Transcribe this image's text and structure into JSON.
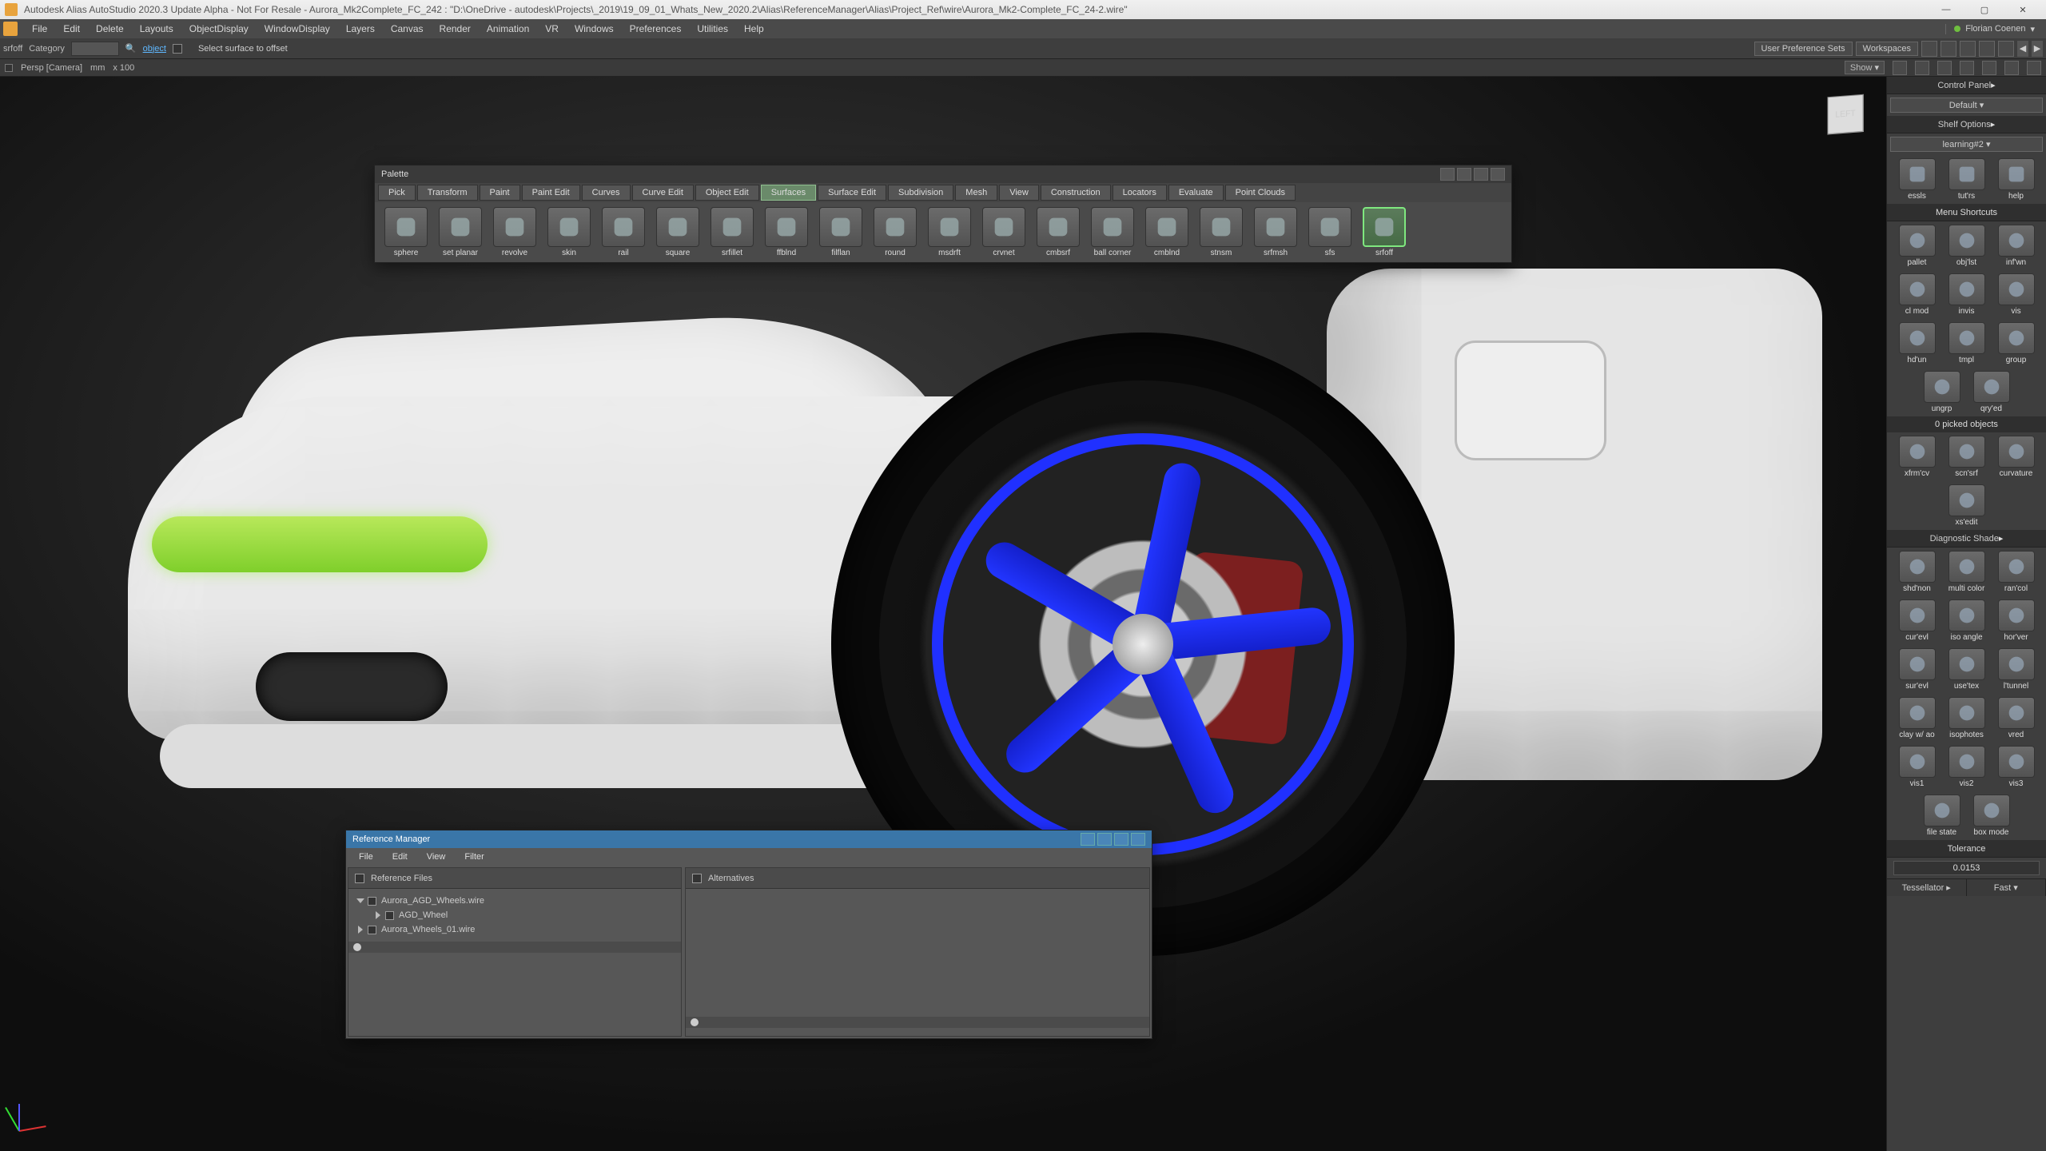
{
  "window": {
    "title": "Autodesk Alias AutoStudio 2020.3 Update Alpha - Not For Resale  -  Aurora_Mk2Complete_FC_242 : \"D:\\OneDrive - autodesk\\Projects\\_2019\\19_09_01_Whats_New_2020.2\\Alias\\ReferenceManager\\Alias\\Project_Ref\\wire\\Aurora_Mk2-Complete_FC_24-2.wire\"",
    "user": "Florian Coenen"
  },
  "menubar": [
    "File",
    "Edit",
    "Delete",
    "Layouts",
    "ObjectDisplay",
    "WindowDisplay",
    "Layers",
    "Canvas",
    "Render",
    "Animation",
    "VR",
    "Windows",
    "Preferences",
    "Utilities",
    "Help"
  ],
  "toolrow": {
    "active_tool": "srfoff",
    "category_label": "Category",
    "object_link": "object",
    "command_hint": "Select surface to offset",
    "user_pref": "User Preference Sets",
    "workspaces": "Workspaces"
  },
  "statusrow": {
    "camera": "Persp [Camera]",
    "units": "mm",
    "zoom": "x 100",
    "show": "Show"
  },
  "palette": {
    "title": "Palette",
    "tabs": [
      "Pick",
      "Transform",
      "Paint",
      "Paint Edit",
      "Curves",
      "Curve Edit",
      "Object Edit",
      "Surfaces",
      "Surface Edit",
      "Subdivision",
      "Mesh",
      "View",
      "Construction",
      "Locators",
      "Evaluate",
      "Point Clouds"
    ],
    "active_tab": "Surfaces",
    "tools": [
      "sphere",
      "set planar",
      "revolve",
      "skin",
      "rail",
      "square",
      "srfillet",
      "ffblnd",
      "filflan",
      "round",
      "msdrft",
      "crvnet",
      "cmbsrf",
      "ball corner",
      "cmblnd",
      "stnsm",
      "srfmsh",
      "sfs",
      "srfoff"
    ],
    "selected_tool": "srfoff"
  },
  "refmgr": {
    "title": "Reference Manager",
    "menus": [
      "File",
      "Edit",
      "View",
      "Filter"
    ],
    "left_header": "Reference Files",
    "right_header": "Alternatives",
    "tree": [
      {
        "label": "Aurora_AGD_Wheels.wire",
        "depth": 0,
        "expanded": true,
        "dim": false
      },
      {
        "label": "AGD_Wheel",
        "depth": 1,
        "expanded": false,
        "dim": false
      },
      {
        "label": "Aurora_Wheels_01.wire",
        "depth": 0,
        "expanded": false,
        "dim": true
      }
    ]
  },
  "sidepanel": {
    "control_panel": "Control Panel",
    "default": "Default",
    "shelf_options": "Shelf Options",
    "shelf_preset": "learning#2",
    "row1": [
      {
        "name": "essls",
        "label": "essls"
      },
      {
        "name": "tutrs",
        "label": "tut'rs"
      },
      {
        "name": "help",
        "label": "help"
      }
    ],
    "menu_shortcuts": "Menu Shortcuts",
    "shortcut_rows": [
      [
        {
          "n": "pallet",
          "l": "pallet"
        },
        {
          "n": "objlst",
          "l": "obj'lst"
        },
        {
          "n": "infwn",
          "l": "inf'wn"
        }
      ],
      [
        {
          "n": "clmod",
          "l": "cl mod"
        },
        {
          "n": "invis",
          "l": "invis"
        },
        {
          "n": "vis",
          "l": "vis"
        }
      ],
      [
        {
          "n": "hdun",
          "l": "hd'un"
        },
        {
          "n": "tmpl",
          "l": "tmpl"
        },
        {
          "n": "group",
          "l": "group"
        }
      ],
      [
        {
          "n": "ungrp",
          "l": "ungrp"
        },
        {
          "n": "qryed",
          "l": "qry'ed"
        }
      ]
    ],
    "picked": "0 picked objects",
    "row_xform": [
      [
        {
          "n": "xfrmcv",
          "l": "xfrm'cv"
        },
        {
          "n": "scnsrf",
          "l": "scn'srf"
        },
        {
          "n": "curvature",
          "l": "curvature"
        }
      ],
      [
        {
          "n": "xsedit",
          "l": "xs'edit"
        }
      ]
    ],
    "diag_shade": "Diagnostic Shade",
    "diag_rows": [
      [
        {
          "n": "shdnon",
          "l": "shd'non"
        },
        {
          "n": "multicolor",
          "l": "multi color"
        },
        {
          "n": "rancol",
          "l": "ran'col"
        }
      ],
      [
        {
          "n": "curevl",
          "l": "cur'evl"
        },
        {
          "n": "isoangle",
          "l": "iso angle"
        },
        {
          "n": "horver",
          "l": "hor'ver"
        }
      ],
      [
        {
          "n": "surevl",
          "l": "sur'evl"
        },
        {
          "n": "usetex",
          "l": "use'tex"
        },
        {
          "n": "ltunnel",
          "l": "l'tunnel"
        }
      ],
      [
        {
          "n": "clayao",
          "l": "clay w/ ao"
        },
        {
          "n": "isophotes",
          "l": "isophotes"
        },
        {
          "n": "vred",
          "l": "vred"
        }
      ],
      [
        {
          "n": "vis1",
          "l": "vis1"
        },
        {
          "n": "vis2",
          "l": "vis2"
        },
        {
          "n": "vis3",
          "l": "vis3"
        }
      ],
      [
        {
          "n": "filestate",
          "l": "file state"
        },
        {
          "n": "boxmode",
          "l": "box mode"
        }
      ]
    ],
    "tolerance_label": "Tolerance",
    "tolerance_value": "0.0153",
    "tessellator": "Tessellator",
    "fast": "Fast"
  },
  "viewcube": {
    "face": "LEFT"
  }
}
